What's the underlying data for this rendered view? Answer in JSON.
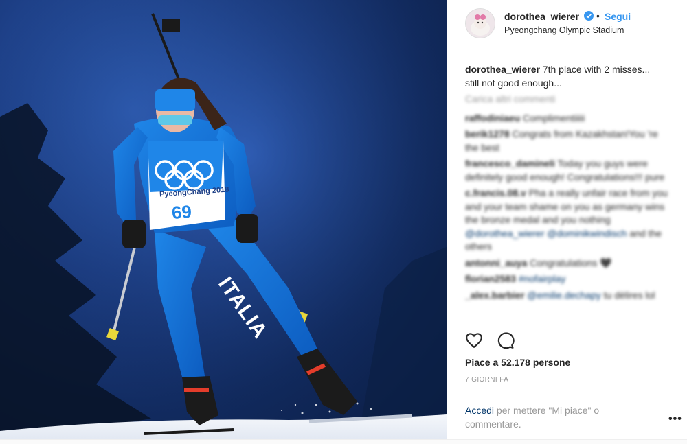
{
  "post": {
    "username": "dorothea_wierer",
    "follow_label": "Segui",
    "separator": "•",
    "location": "Pyeongchang Olympic Stadium",
    "caption_user": "dorothea_wierer",
    "caption_text": "7th place with 2 misses... still not good enough...",
    "bib_number": "69",
    "bib_event": "PyeongChang 2018",
    "suit_text": "ITALIA"
  },
  "comments": {
    "load_more": "Carica altri commenti",
    "items": [
      {
        "user": "raffodiniaeu",
        "text": "Complimentiiiii"
      },
      {
        "user": "berik1278",
        "text": "Congrats from Kazakhstan!You 're the best"
      },
      {
        "user": "francesco_damineli",
        "text": "Today you guys were definitely good enough! Congratulations!!! pure"
      },
      {
        "user": "c.francis.08.v",
        "text": "Pha a really unfair race from you and your team shame on you as germany wins the bronze medal and you nothing",
        "tag": "@dorothea_wierer @dominikwindisch",
        "tail": "and the others"
      },
      {
        "user": "antonni_auya",
        "text": "Congratulations 🖤"
      },
      {
        "user": "florian2583",
        "tag": "#nofairplay",
        "text": ""
      },
      {
        "user": "_alex.barbier",
        "tag": "@emilie.dechapy",
        "text": "tu dèlires lol"
      }
    ]
  },
  "likes_label": "Piace a 52.178 persone",
  "time_label": "7 GIORNI FA",
  "login": {
    "link": "Accedi",
    "text": "per mettere \"Mi piace\" o commentare."
  },
  "more_options": "•••",
  "colors": {
    "link": "#3897f0",
    "muted": "#999999",
    "text": "#262626"
  }
}
